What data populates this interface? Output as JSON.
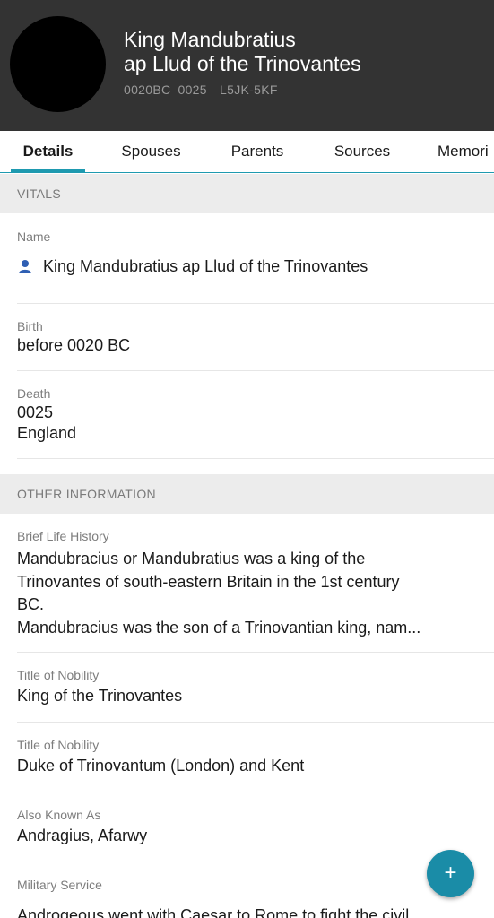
{
  "header": {
    "name_line1": "King Mandubratius",
    "name_line2": "ap Llud of the Trinovantes",
    "lifespan": "0020BC–0025",
    "pid": "L5JK-5KF"
  },
  "tabs": [
    {
      "label": "Details",
      "active": true
    },
    {
      "label": "Spouses",
      "active": false
    },
    {
      "label": "Parents",
      "active": false
    },
    {
      "label": "Sources",
      "active": false
    },
    {
      "label": "Memori",
      "active": false
    }
  ],
  "vitals": {
    "heading": "VITALS",
    "name_label": "Name",
    "name_value": "King Mandubratius ap Llud of the Trinovantes",
    "birth_label": "Birth",
    "birth_value": "before 0020 BC",
    "death_label": "Death",
    "death_date": "0025",
    "death_place": "England"
  },
  "other": {
    "heading": "OTHER INFORMATION",
    "history_label": "Brief Life History",
    "history_lines": [
      "Mandubracius or Mandubratius was a king of the",
      "Trinovantes of south-eastern Britain in the 1st century",
      "BC.",
      "Mandubracius was the son of a Trinovantian king, nam..."
    ],
    "title1_label": "Title of Nobility",
    "title1_value": "King of the Trinovantes",
    "title2_label": "Title of Nobility",
    "title2_value": "Duke of Trinovantum (London) and Kent",
    "aka_label": "Also Known As",
    "aka_value": "Andragius, Afarwy",
    "military_label": "Military Service",
    "military_value": "Androgeous went with Caesar to Rome to fight the civil"
  },
  "fab": {
    "label": "+"
  },
  "colors": {
    "header_bg": "#333333",
    "accent": "#1e9ab0",
    "fab": "#1a8ca7",
    "section_bg": "#ececec",
    "person_icon": "#2f5fb3"
  },
  "icons": {
    "name_icon": "person-icon",
    "fab_icon": "plus-icon"
  }
}
